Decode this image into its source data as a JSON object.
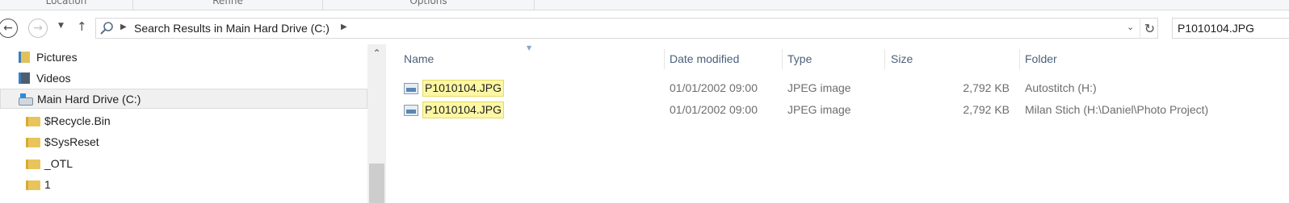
{
  "ribbon": {
    "groups": [
      "Location",
      "Refine",
      "Options"
    ]
  },
  "toolbar": {
    "back_icon": "arrow-left-icon",
    "forward_icon": "arrow-right-icon",
    "recent_icon": "chevron-down-icon",
    "up_icon": "arrow-up-icon",
    "address_separator_icon": "chevron-right-icon",
    "address_text": "Search Results in Main Hard Drive (C:)",
    "refresh_icon": "refresh-icon",
    "search_value": "P1010104.JPG"
  },
  "nav": {
    "items": [
      {
        "label": "Pictures",
        "icon": "pictures-icon"
      },
      {
        "label": "Videos",
        "icon": "videos-icon"
      },
      {
        "label": "Main Hard Drive (C:)",
        "icon": "drive-icon",
        "selected": true
      },
      {
        "label": "$Recycle.Bin",
        "icon": "folder-icon"
      },
      {
        "label": "$SysReset",
        "icon": "folder-icon"
      },
      {
        "label": "_OTL",
        "icon": "folder-icon"
      },
      {
        "label": "1",
        "icon": "folder-icon"
      }
    ]
  },
  "columns": {
    "name": "Name",
    "date_modified": "Date modified",
    "type": "Type",
    "size": "Size",
    "folder": "Folder"
  },
  "files": [
    {
      "name": "P1010104.JPG",
      "date_modified": "01/01/2002 09:00",
      "type": "JPEG image",
      "size": "2,792 KB",
      "folder": "Autostitch (H:)"
    },
    {
      "name": "P1010104.JPG",
      "date_modified": "01/01/2002 09:00",
      "type": "JPEG image",
      "size": "2,792 KB",
      "folder": "Milan Stich (H:\\Daniel\\Photo Project)"
    }
  ],
  "colors": {
    "highlight": "#fdf7a4",
    "header_text": "#4c607a",
    "selected_bg": "#f0f0f0"
  }
}
